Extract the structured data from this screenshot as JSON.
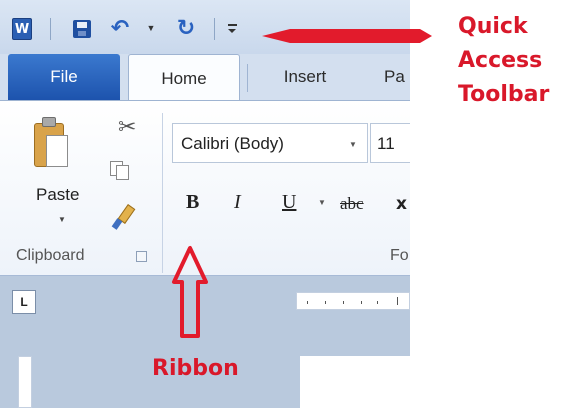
{
  "quick_access_toolbar": {
    "app_logo": "W",
    "items": [
      "save-icon",
      "undo-icon",
      "undo-dropdown",
      "redo-icon",
      "customize-qat-icon"
    ]
  },
  "tabs": [
    {
      "label": "File",
      "active": false
    },
    {
      "label": "Home",
      "active": true
    },
    {
      "label": "Insert",
      "active": false
    },
    {
      "label": "Pa",
      "active": false
    }
  ],
  "ribbon": {
    "clipboard": {
      "paste_label": "Paste",
      "group_label": "Clipboard",
      "icons": [
        "paste-icon",
        "cut-icon",
        "copy-icon",
        "format-painter-icon"
      ]
    },
    "font": {
      "font_name": "Calibri (Body)",
      "font_size": "11",
      "bold": "B",
      "italic": "I",
      "underline": "U",
      "strikethrough": "abc",
      "more": "x",
      "group_label": "Fo"
    }
  },
  "ruler": {
    "corner": "L"
  },
  "annotations": {
    "qat_line1": "Quick",
    "qat_line2": "Access",
    "qat_line3": "Toolbar",
    "ribbon": "Ribbon",
    "color": "#d9182a"
  }
}
